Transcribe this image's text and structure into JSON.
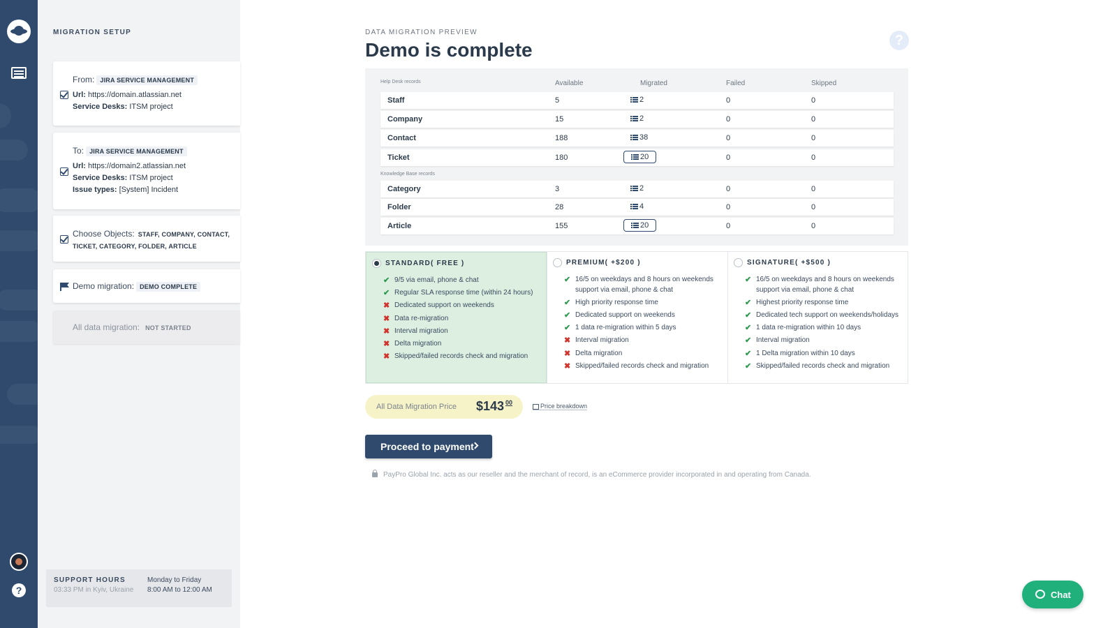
{
  "rail": {
    "logo": "saturn-logo-icon",
    "nav_icon": "list-icon",
    "help": "?"
  },
  "sidebar": {
    "section_title": "MIGRATION SETUP",
    "from": {
      "label": "From:",
      "platform": "JIRA SERVICE MANAGEMENT",
      "url_label": "Url:",
      "url": "https://domain.atlassian.net",
      "desks_label": "Service Desks:",
      "desks": "ITSM project"
    },
    "to": {
      "label": "To:",
      "platform": "JIRA SERVICE MANAGEMENT",
      "url_label": "Url:",
      "url": "https://domain2.atlassian.net",
      "desks_label": "Service Desks:",
      "desks": "ITSM project",
      "issue_label": "Issue types:",
      "issue": "[System] Incident"
    },
    "objects": {
      "label": "Choose Objects:",
      "line1": "STAFF, COMPANY, CONTACT,",
      "line2": "TICKET, CATEGORY, FOLDER, ARTICLE"
    },
    "demo": {
      "label": "Demo migration:",
      "status": "DEMO COMPLETE"
    },
    "full": {
      "label": "All data migration:",
      "status": "NOT STARTED"
    },
    "support": {
      "title": "SUPPORT HOURS",
      "location": "03:33 PM in Kyiv, Ukraine",
      "days": "Monday to Friday",
      "hours": "8:00 AM to 12:00 AM"
    }
  },
  "main": {
    "kicker": "DATA MIGRATION PREVIEW",
    "title": "Demo is complete",
    "help_icon": "?",
    "table": {
      "group1": "Help Desk records",
      "group2": "Knowledge Base records",
      "headers": {
        "available": "Available",
        "migrated": "Migrated",
        "failed": "Failed",
        "skipped": "Skipped"
      },
      "rows": [
        {
          "name": "Staff",
          "available": "5",
          "migrated": "2",
          "failed": "0",
          "skipped": "0"
        },
        {
          "name": "Company",
          "available": "15",
          "migrated": "2",
          "failed": "0",
          "skipped": "0"
        },
        {
          "name": "Contact",
          "available": "188",
          "migrated": "38",
          "failed": "0",
          "skipped": "0"
        },
        {
          "name": "Ticket",
          "available": "180",
          "migrated": "20",
          "failed": "0",
          "skipped": "0"
        },
        {
          "name": "Category",
          "available": "3",
          "migrated": "2",
          "failed": "0",
          "skipped": "0"
        },
        {
          "name": "Folder",
          "available": "28",
          "migrated": "4",
          "failed": "0",
          "skipped": "0"
        },
        {
          "name": "Article",
          "available": "155",
          "migrated": "20",
          "failed": "0",
          "skipped": "0"
        }
      ]
    },
    "plans": [
      {
        "title": "STANDARD( FREE )",
        "selected": true,
        "features": [
          {
            "ok": true,
            "text": "9/5 via email, phone & chat"
          },
          {
            "ok": true,
            "text": "Regular SLA response time (within 24 hours)"
          },
          {
            "ok": false,
            "text": "Dedicated support on weekends"
          },
          {
            "ok": false,
            "text": "Data re-migration"
          },
          {
            "ok": false,
            "text": "Interval migration"
          },
          {
            "ok": false,
            "text": "Delta migration"
          },
          {
            "ok": false,
            "text": "Skipped/failed records check and migration"
          }
        ]
      },
      {
        "title": "PREMIUM( +$200 )",
        "selected": false,
        "features": [
          {
            "ok": true,
            "text": "16/5 on weekdays and 8 hours on weekends support via email, phone & chat"
          },
          {
            "ok": true,
            "text": "High priority response time"
          },
          {
            "ok": true,
            "text": "Dedicated support on weekends"
          },
          {
            "ok": true,
            "text": "1 data re-migration within 5 days"
          },
          {
            "ok": false,
            "text": "Interval migration"
          },
          {
            "ok": false,
            "text": "Delta migration"
          },
          {
            "ok": false,
            "text": "Skipped/failed records check and migration"
          }
        ]
      },
      {
        "title": "SIGNATURE( +$500 )",
        "selected": false,
        "features": [
          {
            "ok": true,
            "text": "16/5 on weekdays and 8 hours on weekends support via email, phone & chat"
          },
          {
            "ok": true,
            "text": "Highest priority response time"
          },
          {
            "ok": true,
            "text": "Dedicated tech support on weekends/holidays"
          },
          {
            "ok": true,
            "text": "1 data re-migration within 10 days"
          },
          {
            "ok": true,
            "text": "Interval migration"
          },
          {
            "ok": true,
            "text": "1 Delta migration within 10 days"
          },
          {
            "ok": true,
            "text": "Skipped/failed records check and migration"
          }
        ]
      }
    ],
    "price": {
      "label": "All Data Migration Price",
      "amount": "$143",
      "cents": "00",
      "breakdown": "Price breakdown"
    },
    "pay_button": "Proceed to payment",
    "disclaimer": "PayPro Global Inc. acts as our reseller and the merchant of record, is an eCommerce provider incorporated in and operating from Canada."
  },
  "chat": {
    "label": "Chat"
  },
  "colors": {
    "navy": "#2f4a6d",
    "green": "#1fb07c",
    "plan_selected": "#dcefe1",
    "price_bg": "#f7f3c8"
  }
}
